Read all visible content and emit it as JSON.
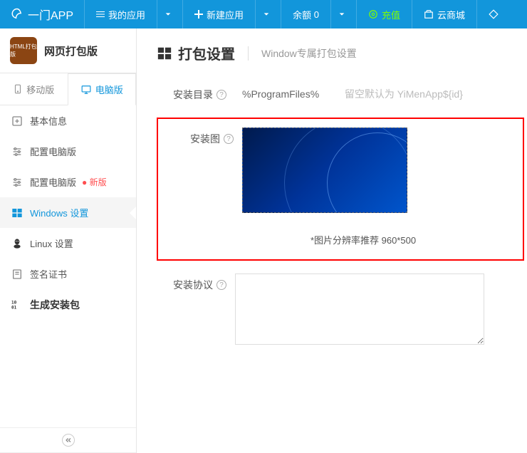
{
  "topbar": {
    "logo": "一门APP",
    "myApps": "我的应用",
    "newApp": "新建应用",
    "balanceLabel": "余额",
    "balanceValue": "0",
    "recharge": "充值",
    "cloudStore": "云商城"
  },
  "app": {
    "iconText": "HTML打包版",
    "name": "网页打包版"
  },
  "tabs": {
    "mobile": "移动版",
    "desktop": "电脑版"
  },
  "menu": {
    "basicInfo": "基本信息",
    "configDesktop": "配置电脑版",
    "configDesktopNew": "配置电脑版",
    "newBadge": "● 新版",
    "windowsSettings": "Windows 设置",
    "linuxSettings": "Linux 设置",
    "signCert": "签名证书",
    "generatePackage": "生成安装包"
  },
  "page": {
    "title": "打包设置",
    "subtitle": "Window专属打包设置"
  },
  "form": {
    "installDirLabel": "安装目录",
    "installDirValue": "%ProgramFiles%",
    "installDirPlaceholder": "留空默认为 YiMenApp${id}",
    "installImageLabel": "安装图",
    "installImageHint": "*图片分辨率推荐 960*500",
    "installAgreementLabel": "安装协议"
  }
}
